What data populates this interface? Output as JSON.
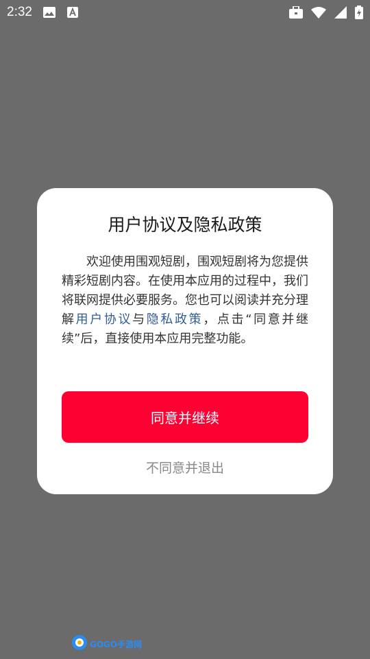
{
  "status_bar": {
    "time": "2:32",
    "icons": [
      "image-icon",
      "font-a-icon",
      "briefcase-icon",
      "wifi-icon",
      "signal-icon",
      "battery-charging-icon"
    ]
  },
  "dialog": {
    "title": "用户协议及隐私政策",
    "body_prefix": "欢迎使用围观短剧，围观短剧将为您提供精彩短剧内容。在使用本应用的过程中，我们将联网提供必要服务。您也可以阅读并充分理解",
    "link_user_agreement": "用户协议",
    "connector": "与",
    "link_privacy_policy": "隐私政策",
    "body_suffix": "，点击“同意并继续”后，直接使用本应用完整功能。",
    "agree_label": "同意并继续",
    "decline_label": "不同意并退出"
  },
  "watermark": {
    "text": "GOGO手游网"
  },
  "colors": {
    "overlay": "#6b6b6b",
    "primary": "#ff0033",
    "link": "#2f5d9a"
  }
}
